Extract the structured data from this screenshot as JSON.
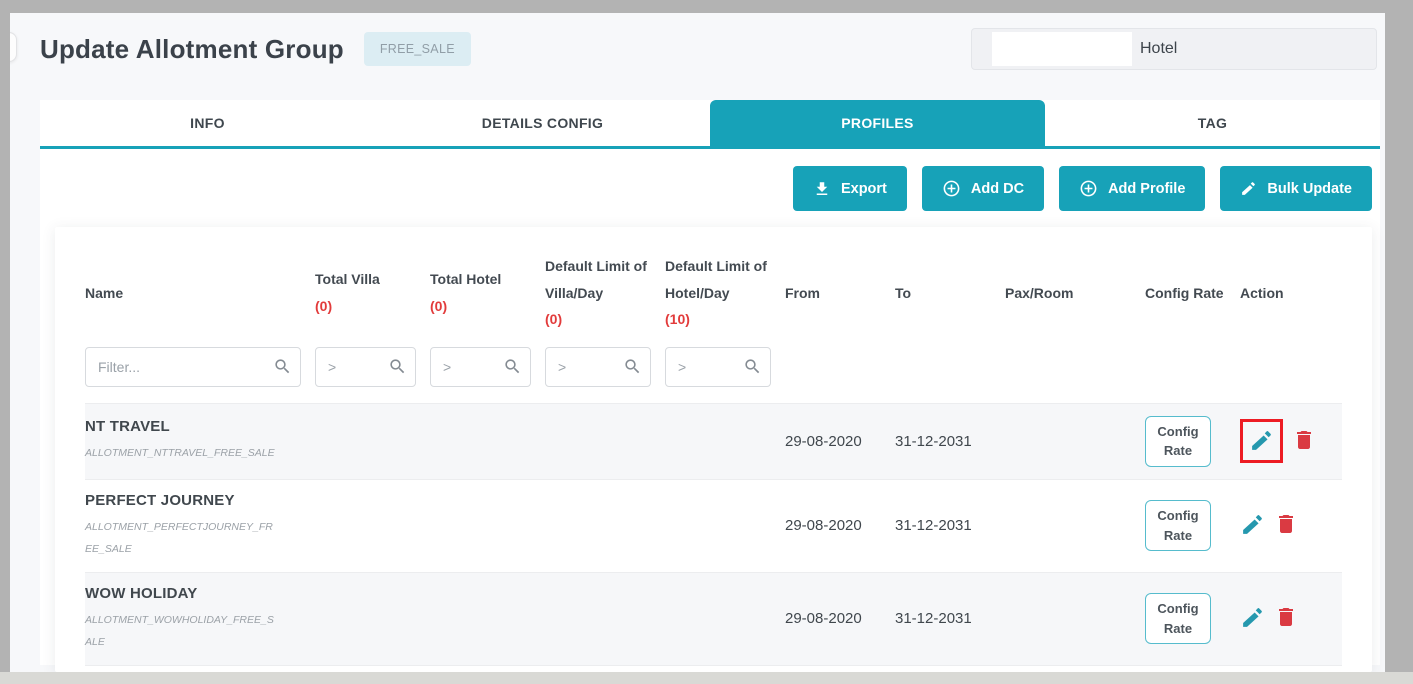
{
  "page": {
    "title": "Update Allotment Group",
    "badge": "FREE_SALE",
    "hotel_label": "Hotel"
  },
  "tabs": [
    {
      "label": "INFO",
      "active": false
    },
    {
      "label": "DETAILS CONFIG",
      "active": false
    },
    {
      "label": "PROFILES",
      "active": true
    },
    {
      "label": "TAG",
      "active": false
    }
  ],
  "toolbar": {
    "export_label": "Export",
    "add_dc_label": "Add DC",
    "add_profile_label": "Add Profile",
    "bulk_update_label": "Bulk Update"
  },
  "table": {
    "headers": {
      "name": "Name",
      "total_villa": "Total Villa",
      "total_villa_count": "(0)",
      "total_hotel": "Total Hotel",
      "total_hotel_count": "(0)",
      "default_limit_villa": "Default Limit of Villa/Day",
      "default_limit_villa_count": "(0)",
      "default_limit_hotel": "Default Limit of Hotel/Day",
      "default_limit_hotel_count": "(10)",
      "from": "From",
      "to": "To",
      "pax_room": "Pax/Room",
      "config_rate": "Config Rate",
      "action": "Action"
    },
    "filters": {
      "name_placeholder": "Filter...",
      "numeric_placeholder": ">"
    },
    "config_rate_label": "Config Rate",
    "rows": [
      {
        "name": "NT TRAVEL",
        "code": "ALLOTMENT_NTTRAVEL_FREE_SALE",
        "from": "29-08-2020",
        "to": "31-12-2031",
        "edit_highlighted": true
      },
      {
        "name": "PERFECT JOURNEY",
        "code": "ALLOTMENT_PERFECTJOURNEY_FREE_SALE",
        "from": "29-08-2020",
        "to": "31-12-2031",
        "edit_highlighted": false
      },
      {
        "name": "WOW HOLIDAY",
        "code": "ALLOTMENT_WOWHOLIDAY_FREE_SALE",
        "from": "29-08-2020",
        "to": "31-12-2031",
        "edit_highlighted": false
      }
    ]
  },
  "icons": {
    "export": "download-icon",
    "add_dc": "plus-circle-icon",
    "add_profile": "plus-circle-icon",
    "bulk_update": "pencil-icon",
    "filter": "search-icon",
    "row_edit": "pencil-icon",
    "row_delete": "trash-icon"
  },
  "colors": {
    "accent_teal": "#17a2b8",
    "count_red": "#e23b3b",
    "trash_red": "#da3a42",
    "highlight_box_red": "#ed1c24",
    "badge_bg": "#dcedf3",
    "page_bg": "#f7f8fa",
    "frame_gray": "#b3b3b3"
  }
}
